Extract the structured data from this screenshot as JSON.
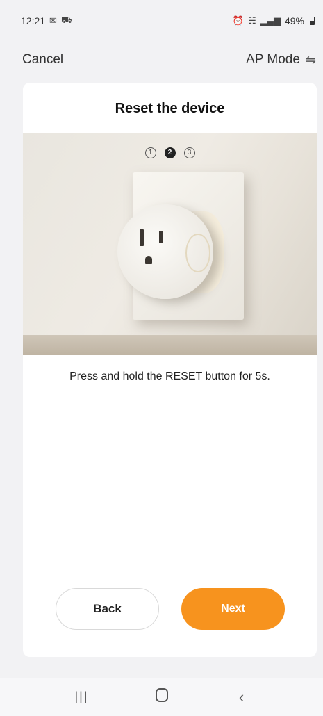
{
  "status_bar": {
    "time": "12:21",
    "left_icons": [
      "mail-icon",
      "app-notification-icon"
    ],
    "right_icons": [
      "alarm-icon",
      "wifi-icon",
      "signal-icon"
    ],
    "battery": "49%"
  },
  "top_nav": {
    "cancel_label": "Cancel",
    "mode_label": "AP Mode",
    "mode_icon": "swap-icon"
  },
  "card": {
    "title": "Reset the device",
    "steps": [
      "1",
      "2",
      "3"
    ],
    "active_step": 2,
    "instruction": "Press and hold the RESET button for 5s.",
    "back_label": "Back",
    "next_label": "Next",
    "accent_color": "#f7931e"
  },
  "nav_bar": {
    "icons": [
      "recent-apps-icon",
      "home-icon",
      "back-icon"
    ]
  }
}
